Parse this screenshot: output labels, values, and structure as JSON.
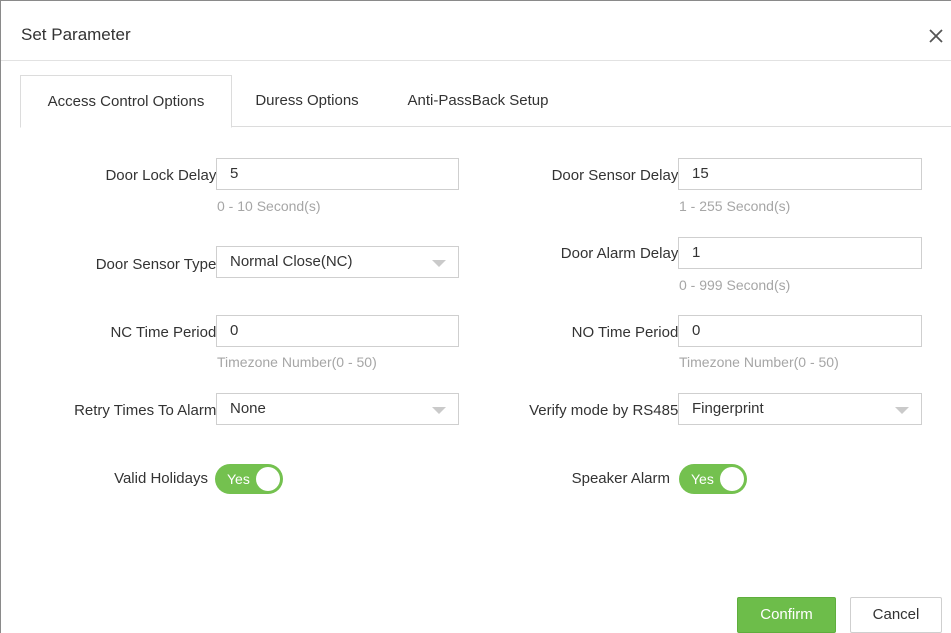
{
  "dialog": {
    "title": "Set Parameter",
    "close_symbol": "×"
  },
  "tabs": [
    {
      "label": "Access Control Options",
      "active": true
    },
    {
      "label": "Duress Options",
      "active": false
    },
    {
      "label": "Anti-PassBack Setup",
      "active": false
    }
  ],
  "required_mark": "*",
  "fields": {
    "door_lock_delay": {
      "label": "Door Lock Delay",
      "value": "5",
      "hint": "0 - 10 Second(s)"
    },
    "door_sensor_delay": {
      "label": "Door Sensor Delay",
      "value": "15",
      "hint": "1 - 255 Second(s)"
    },
    "door_sensor_type": {
      "label": "Door Sensor Type",
      "value": "Normal Close(NC)"
    },
    "door_alarm_delay": {
      "label": "Door Alarm Delay",
      "value": "1",
      "hint": "0 - 999 Second(s)"
    },
    "nc_time_period": {
      "label": "NC Time Period",
      "value": "0",
      "hint": "Timezone Number(0 - 50)"
    },
    "no_time_period": {
      "label": "NO Time Period",
      "value": "0",
      "hint": "Timezone Number(0 - 50)"
    },
    "retry_times": {
      "label": "Retry Times To Alarm",
      "value": "None"
    },
    "verify_mode": {
      "label": "Verify mode by RS485",
      "value": "Fingerprint"
    },
    "valid_holidays": {
      "label": "Valid Holidays",
      "toggle_text": "Yes",
      "on": true
    },
    "speaker_alarm": {
      "label": "Speaker Alarm",
      "toggle_text": "Yes",
      "on": true
    }
  },
  "buttons": {
    "confirm": "Confirm",
    "cancel": "Cancel"
  },
  "colors": {
    "accent_green": "#6dbd4a",
    "required_red": "#e0393e",
    "hint_gray": "#a6a6a6"
  },
  "icons": {
    "close": "close-icon",
    "dropdown": "chevron-down-icon"
  }
}
